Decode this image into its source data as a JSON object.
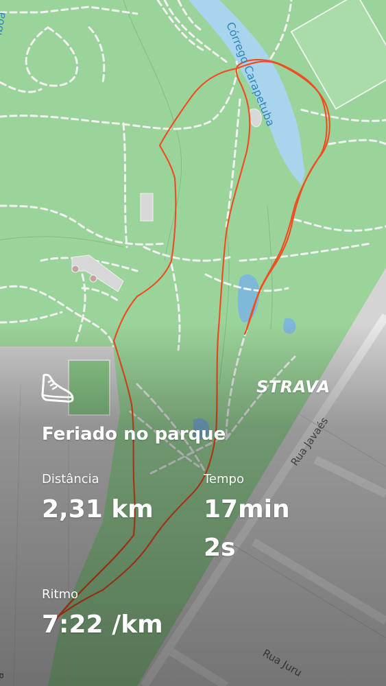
{
  "activity": {
    "title": "Feriado no parque",
    "icon": "running-shoe-icon"
  },
  "brand": "STRAVA",
  "stats": {
    "distance": {
      "label": "Distância",
      "value": "2,31 km"
    },
    "time": {
      "label": "Tempo",
      "value_line1": "17min",
      "value_line2": "2s"
    },
    "pace": {
      "label": "Ritmo",
      "value": "7:22 /km"
    }
  },
  "map_labels": {
    "stream": "Córrego Carapetuba",
    "street_main": "Rua Javaés",
    "street_bottom": "Rua Juru",
    "street_partial_left": "lboa",
    "street_partial_bottom_left": "á"
  },
  "colors": {
    "route": "#ee4f22",
    "park": "#9bd49a",
    "water": "#a9d4ee",
    "urban": "#c9c9c9",
    "text": "#ffffff"
  }
}
